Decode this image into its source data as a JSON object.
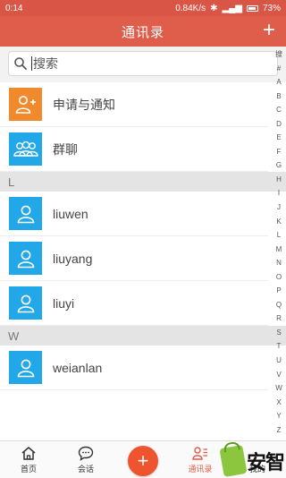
{
  "status_bar": {
    "time": "0:14",
    "speed": "0.84K/s",
    "battery": "73%"
  },
  "header": {
    "title": "通讯录"
  },
  "search": {
    "placeholder": "搜索"
  },
  "top_items": [
    {
      "label": "申请与通知",
      "icon": "add-contact-icon"
    },
    {
      "label": "群聊",
      "icon": "group-icon"
    }
  ],
  "sections": [
    {
      "letter": "L",
      "contacts": [
        "liuwen",
        "liuyang",
        "liuyi"
      ]
    },
    {
      "letter": "W",
      "contacts": [
        "weianlan"
      ]
    }
  ],
  "index_letters": [
    "搜",
    "#",
    "A",
    "B",
    "C",
    "D",
    "E",
    "F",
    "G",
    "H",
    "I",
    "J",
    "K",
    "L",
    "M",
    "N",
    "O",
    "P",
    "Q",
    "R",
    "S",
    "T",
    "U",
    "V",
    "W",
    "X",
    "Y",
    "Z"
  ],
  "bottom_nav": {
    "home": "首页",
    "chat": "会话",
    "contacts": "通讯录",
    "mine": "我的"
  },
  "watermark": {
    "text": "安智"
  },
  "colors": {
    "primary": "#de5e4b",
    "orange": "#f08a2c",
    "blue": "#22a7e8",
    "fab": "#f0542e"
  }
}
